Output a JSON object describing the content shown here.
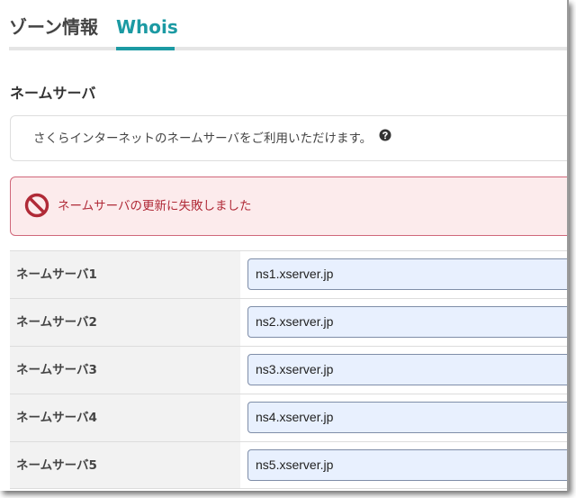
{
  "tabs": [
    {
      "label": "ゾーン情報",
      "active": false
    },
    {
      "label": "Whois",
      "active": true
    }
  ],
  "section": {
    "title": "ネームサーバ"
  },
  "info": {
    "text": "さくらインターネットのネームサーバをご利用いただけます。",
    "help_icon": "question-circle-icon"
  },
  "alert": {
    "icon": "prohibited-icon",
    "text": "ネームサーバの更新に失敗しました"
  },
  "nameservers": [
    {
      "label": "ネームサーバ1",
      "value": "ns1.xserver.jp"
    },
    {
      "label": "ネームサーバ2",
      "value": "ns2.xserver.jp"
    },
    {
      "label": "ネームサーバ3",
      "value": "ns3.xserver.jp"
    },
    {
      "label": "ネームサーバ4",
      "value": "ns4.xserver.jp"
    },
    {
      "label": "ネームサーバ5",
      "value": "ns5.xserver.jp"
    }
  ],
  "colors": {
    "accent": "#1c9aa3",
    "error_text": "#b02a37",
    "error_bg": "#fcebec",
    "error_border": "#d0677a",
    "input_bg": "#e8f0fe"
  }
}
